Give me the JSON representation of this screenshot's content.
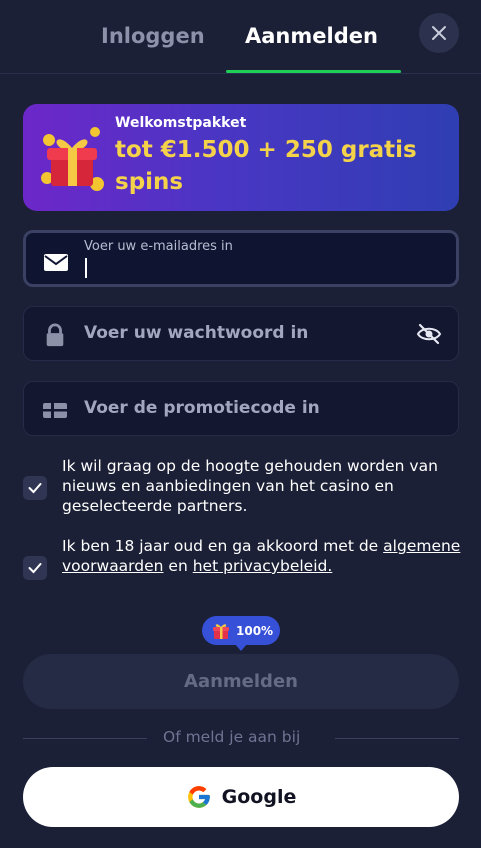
{
  "tabs": [
    {
      "label": "Inloggen",
      "active": false
    },
    {
      "label": "Aanmelden",
      "active": true
    }
  ],
  "banner": {
    "kicker": "Welkomstpakket",
    "title": "tot €1.500 + 250 gratis spins",
    "icon": "gift-icon"
  },
  "form": {
    "email": {
      "label": "Voer uw e-mailadres in",
      "value": "",
      "icon": "envelope-icon"
    },
    "password": {
      "placeholder": "Voer uw wachtwoord in",
      "icon": "lock-icon",
      "toggle_icon": "eye-off-icon"
    },
    "promo": {
      "placeholder": "Voer de promotiecode in",
      "icon": "gift-card-icon"
    }
  },
  "consents": [
    {
      "checked": true,
      "text": "Ik wil graag op de hoogte gehouden worden van nieuws en aanbiedingen van het casino en geselecteerde partners."
    },
    {
      "checked": true,
      "text_before": "Ik ben 18 jaar oud en ga akkoord met de",
      "link1": "algemene voorwaarden",
      "text_mid": "en",
      "link2": "het privacybeleid."
    }
  ],
  "bonus_badge": {
    "text": "100%",
    "icon": "gift-icon"
  },
  "submit": {
    "label": "Aanmelden",
    "disabled": true
  },
  "divider": {
    "text": "Of meld je aan bij"
  },
  "social": {
    "google_label": "Google"
  },
  "colors": {
    "background": "#1b2036",
    "accent_green": "#1fce57",
    "banner_text": "#f4d34a",
    "badge_blue": "#3650d8"
  }
}
